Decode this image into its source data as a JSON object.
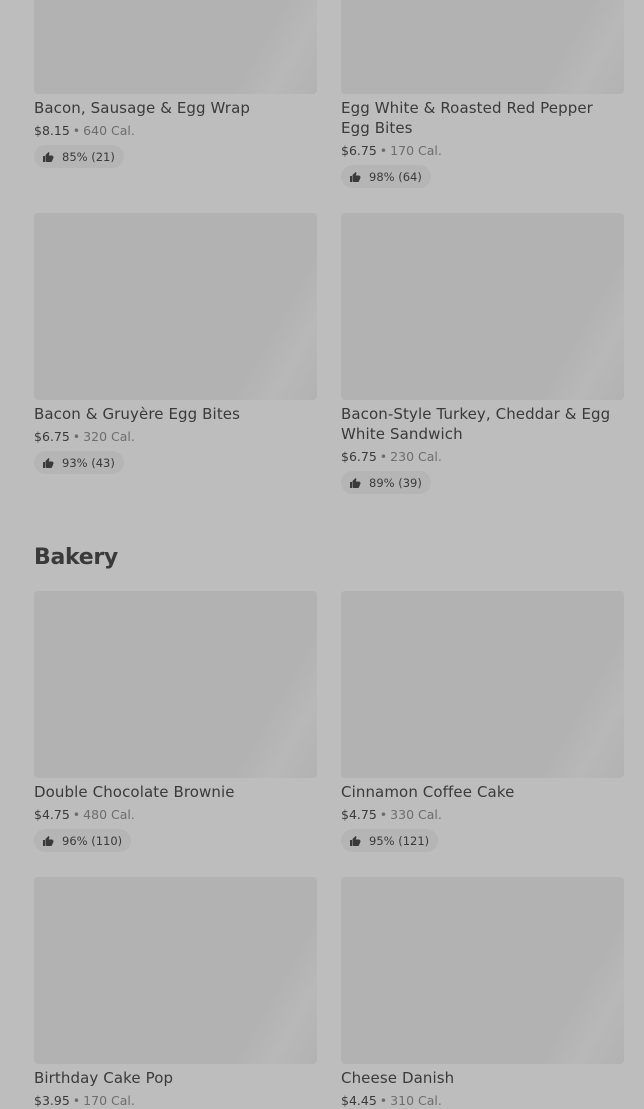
{
  "sections": [
    {
      "items": [
        {
          "name": "Bacon, Sausage & Egg Wrap",
          "price": "$8.15",
          "calories": "640 Cal.",
          "rating": "85% (21)",
          "icon": "thumbs-up-icon"
        },
        {
          "name": "Egg White & Roasted Red Pepper Egg Bites",
          "price": "$6.75",
          "calories": "170 Cal.",
          "rating": "98% (64)",
          "icon": "thumbs-up-icon"
        },
        {
          "name": "Bacon & Gruyère Egg Bites",
          "price": "$6.75",
          "calories": "320 Cal.",
          "rating": "93% (43)",
          "icon": "thumbs-up-icon"
        },
        {
          "name": "Bacon-Style Turkey, Cheddar & Egg White Sandwich",
          "price": "$6.75",
          "calories": "230 Cal.",
          "rating": "89% (39)",
          "icon": "thumbs-up-icon"
        }
      ]
    },
    {
      "title": "Bakery",
      "items": [
        {
          "name": "Double Chocolate Brownie",
          "price": "$4.75",
          "calories": "480 Cal.",
          "rating": "96% (110)",
          "icon": "thumbs-up-icon"
        },
        {
          "name": "Cinnamon Coffee Cake",
          "price": "$4.75",
          "calories": "330 Cal.",
          "rating": "95% (121)",
          "icon": "thumbs-up-icon"
        },
        {
          "name": "Birthday Cake Pop",
          "price": "$3.95",
          "calories": "170 Cal."
        },
        {
          "name": "Cheese Danish",
          "price": "$4.45",
          "calories": "310 Cal."
        }
      ]
    }
  ],
  "separator": "•",
  "colors": {
    "background": "#bdbdbd",
    "image_placeholder": "#b2b2b2",
    "text_primary": "#3a3a3a",
    "text_secondary": "#6d6d6d"
  }
}
